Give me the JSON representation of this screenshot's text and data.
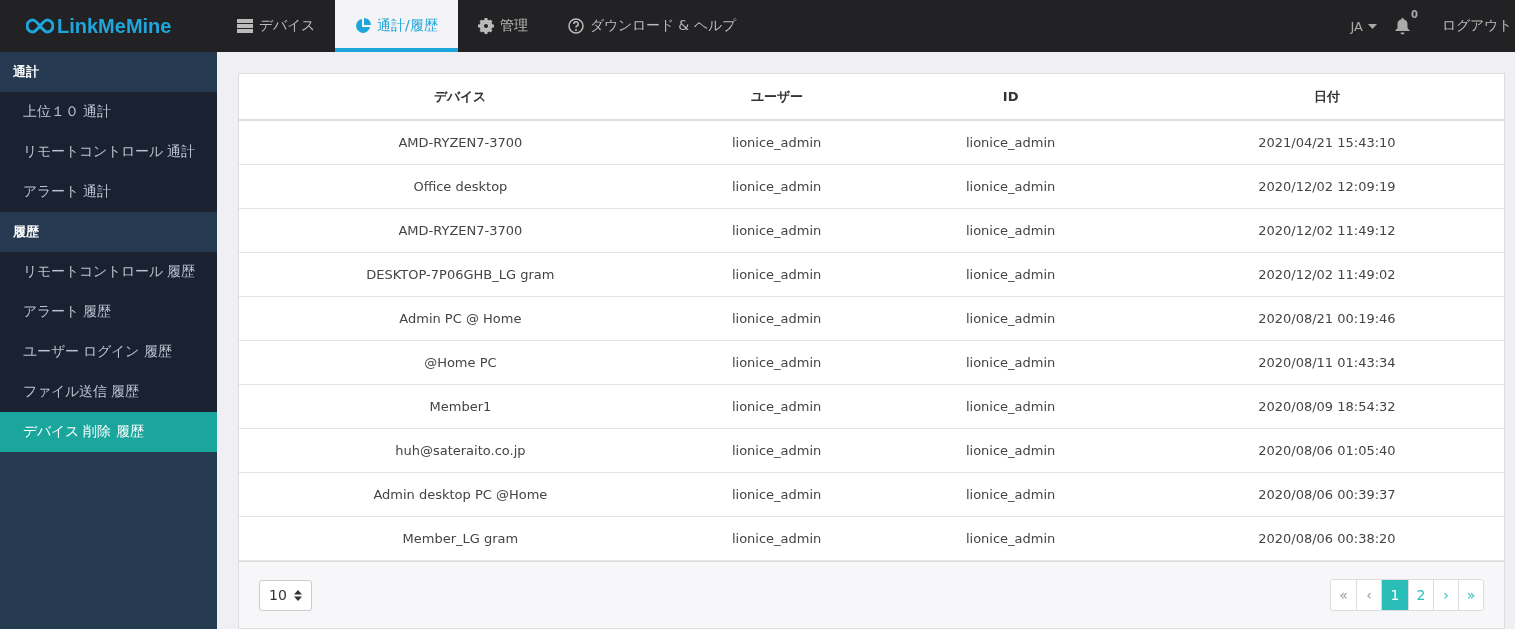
{
  "brand": {
    "name": "LinkMeMine"
  },
  "nav": [
    {
      "label": "デバイス",
      "selected": false
    },
    {
      "label": "通計/履歴",
      "selected": true
    },
    {
      "label": "管理",
      "selected": false
    },
    {
      "label": "ダウンロード & ヘルプ",
      "selected": false
    }
  ],
  "header_right": {
    "language": "JA",
    "notification_count": "0",
    "logout": "ログアウト"
  },
  "sidebar": [
    {
      "heading": "通計",
      "items": [
        {
          "label": "上位１０ 通計",
          "selected": false
        },
        {
          "label": "リモートコントロール 通計",
          "selected": false
        },
        {
          "label": "アラート 通計",
          "selected": false
        }
      ]
    },
    {
      "heading": "履歴",
      "items": [
        {
          "label": "リモートコントロール 履歴",
          "selected": false
        },
        {
          "label": "アラート 履歴",
          "selected": false
        },
        {
          "label": "ユーザー ログイン 履歴",
          "selected": false
        },
        {
          "label": "ファイル送信 履歴",
          "selected": false
        },
        {
          "label": "デバイス 削除 履歴",
          "selected": true
        }
      ]
    }
  ],
  "table": {
    "columns": [
      "デバイス",
      "ユーザー",
      "ID",
      "日付"
    ],
    "rows": [
      [
        "AMD-RYZEN7-3700",
        "lionice_admin",
        "lionice_admin",
        "2021/04/21 15:43:10"
      ],
      [
        "Office desktop",
        "lionice_admin",
        "lionice_admin",
        "2020/12/02 12:09:19"
      ],
      [
        "AMD-RYZEN7-3700",
        "lionice_admin",
        "lionice_admin",
        "2020/12/02 11:49:12"
      ],
      [
        "DESKTOP-7P06GHB_LG gram",
        "lionice_admin",
        "lionice_admin",
        "2020/12/02 11:49:02"
      ],
      [
        "Admin PC @ Home",
        "lionice_admin",
        "lionice_admin",
        "2020/08/21 00:19:46"
      ],
      [
        "@Home PC",
        "lionice_admin",
        "lionice_admin",
        "2020/08/11 01:43:34"
      ],
      [
        "Member1",
        "lionice_admin",
        "lionice_admin",
        "2020/08/09 18:54:32"
      ],
      [
        "huh@sateraito.co.jp",
        "lionice_admin",
        "lionice_admin",
        "2020/08/06 01:05:40"
      ],
      [
        "Admin desktop PC @Home",
        "lionice_admin",
        "lionice_admin",
        "2020/08/06 00:39:37"
      ],
      [
        "Member_LG gram",
        "lionice_admin",
        "lionice_admin",
        "2020/08/06 00:38:20"
      ]
    ]
  },
  "page_size": "10",
  "pagination": [
    {
      "label": "«",
      "selected": false,
      "disabled": true
    },
    {
      "label": "‹",
      "selected": false,
      "disabled": true
    },
    {
      "label": "1",
      "selected": true,
      "disabled": false
    },
    {
      "label": "2",
      "selected": false,
      "disabled": false
    },
    {
      "label": "›",
      "selected": false,
      "disabled": false
    },
    {
      "label": "»",
      "selected": false,
      "disabled": false
    }
  ]
}
